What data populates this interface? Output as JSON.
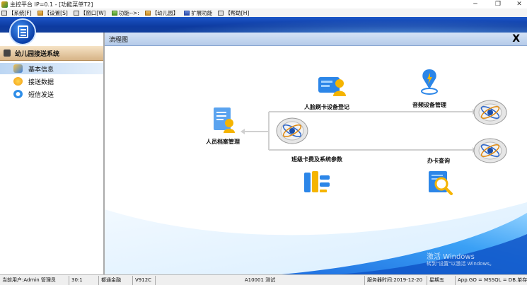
{
  "window": {
    "title": "主控平台 IP=0.1 - [功能菜单T2]",
    "minimize": "─",
    "maximize": "❐",
    "close": "✕"
  },
  "menu": [
    {
      "label": "【系统[F]",
      "icon": "system-icon"
    },
    {
      "label": "【设置[S]",
      "icon": "settings-icon"
    },
    {
      "label": "【窗口[W]",
      "icon": "window-icon"
    },
    {
      "label": "功能-->:",
      "icon": "function-icon"
    },
    {
      "label": "【幼儿园】",
      "icon": "kindergarten-icon"
    },
    {
      "label": "扩展功能",
      "icon": "extension-icon"
    },
    {
      "label": "【帮助[H]",
      "icon": "help-icon"
    }
  ],
  "sidebar": {
    "header": "幼儿园接送系统",
    "items": [
      {
        "label": "基本信息",
        "selected": true
      },
      {
        "label": "接送数据",
        "selected": false
      },
      {
        "label": "短信发送",
        "selected": false
      }
    ]
  },
  "main": {
    "title": "流程图",
    "close": "X",
    "nodes": {
      "personnel": "人员档案管理",
      "face_card": "人脸刷卡设备登记",
      "audio": "音频设备管理",
      "class_fee": "班级卡费及系统参数",
      "card_query": "办卡查询"
    },
    "watermark_title": "激活 Windows",
    "watermark_sub": "转到\"设置\"以激活 Windows。"
  },
  "status": {
    "user": "当前用户:Admin 管理员",
    "count": "30:1",
    "dept": "都通金融",
    "version": "V912C",
    "school": "A10001 测试",
    "server_time": "服务器时间:2019-12-20",
    "weekday": "星期五",
    "db": "App.GO = MSSQL = DB.单存"
  },
  "colors": {
    "banner": "#1c56c7",
    "accent": "#0d3aa0",
    "sidebar_header": "#d7b487",
    "selected_item": "#bcd6f3"
  }
}
